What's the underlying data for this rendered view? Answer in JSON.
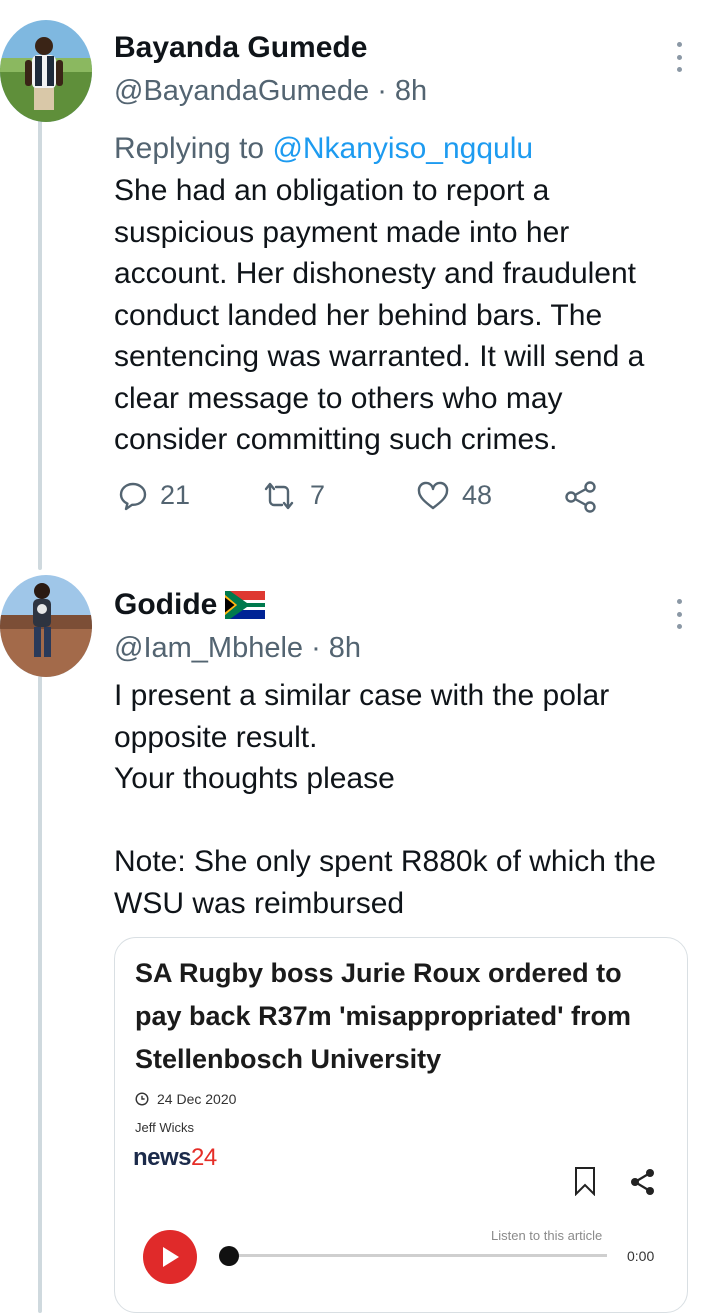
{
  "tweets": [
    {
      "display_name": "Bayanda Gumede",
      "handle": "@BayandaGumede",
      "time": "· 8h",
      "replying_prefix": "Replying to ",
      "replying_to": "@Nkanyiso_ngqulu",
      "text": "She had an obligation to report a\nsuspicious payment made into her\naccount. Her dishonesty and fraudulent\nconduct landed her behind bars. The\nsentencing was warranted. It will send a\nclear message to others who may\nconsider committing such crimes.",
      "replies": "21",
      "retweets": "7",
      "likes": "48"
    },
    {
      "display_name": "Godide",
      "handle": "@Iam_Mbhele",
      "time": "· 8h",
      "text": "I present a similar case with the polar\nopposite result.\nYour thoughts please\n\nNote: She only spent R880k of which the\nWSU was reimbursed",
      "card": {
        "title": "SA Rugby boss Jurie Roux ordered to pay back R37m 'misappropriated' from Stellenbosch University",
        "date": "24 Dec 2020",
        "author": "Jeff Wicks",
        "brand_news": "news",
        "brand_num": "24",
        "listen_label": "Listen to this article",
        "audio_time": "0:00"
      }
    }
  ],
  "colors": {
    "secondary_text": "#536471",
    "link": "#1d9bf0",
    "thread_line": "#cfd9de",
    "play_button": "#e02a2a"
  }
}
